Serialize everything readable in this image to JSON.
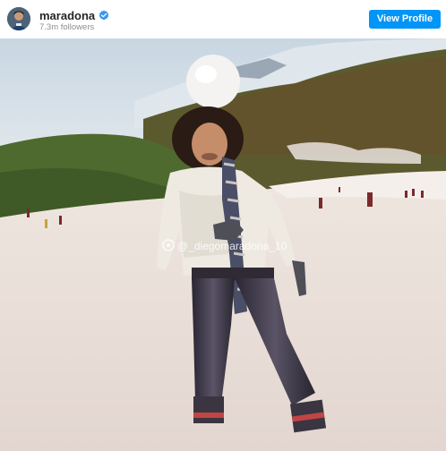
{
  "post": {
    "username": "maradona",
    "followers": "7.3m followers",
    "view_profile_label": "View Profile",
    "verified_icon": "verified-badge-icon",
    "accent_color": "#0095f6"
  },
  "photo": {
    "watermark": "@_diegomaradona_10"
  }
}
